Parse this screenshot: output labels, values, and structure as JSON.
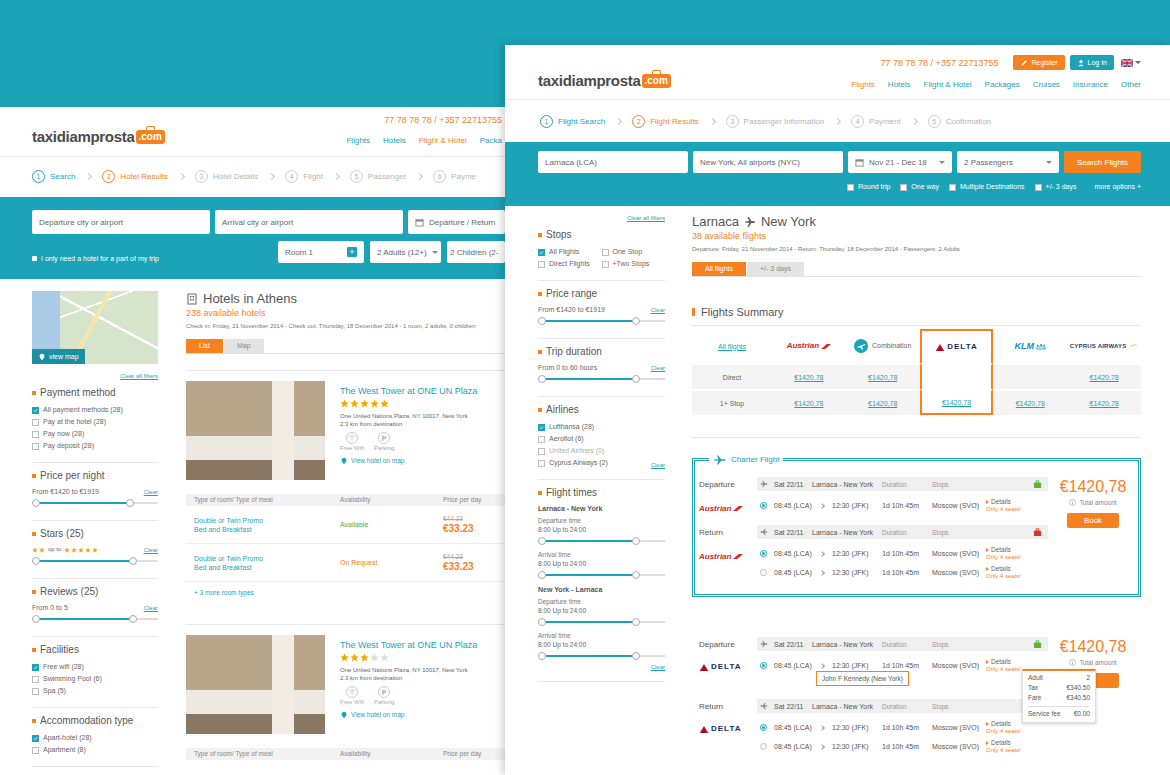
{
  "hotel_page": {
    "header": {
      "logo": {
        "name": "taxidiamprosta",
        "tld": ".com"
      },
      "phone": "77 78 78 78 / +357 22713755",
      "nav": [
        {
          "label": "Flights",
          "selected": false
        },
        {
          "label": "Hotels",
          "selected": false
        },
        {
          "label": "Flight & Hotel",
          "selected": true
        },
        {
          "label": "Packa",
          "selected": false
        }
      ]
    },
    "steps": [
      {
        "number": "1",
        "label": "Search",
        "done": true,
        "selected": false
      },
      {
        "number": "2",
        "label": "Hotel Results",
        "done": false,
        "selected": true
      },
      {
        "number": "3",
        "label": "Hotel Details",
        "done": false,
        "selected": false
      },
      {
        "number": "4",
        "label": "Flight",
        "done": false,
        "selected": false
      },
      {
        "number": "5",
        "label": "Passenger",
        "done": false,
        "selected": false
      },
      {
        "number": "6",
        "label": "Payme",
        "done": false,
        "selected": false
      }
    ],
    "search": {
      "departure": "Departure city or airport",
      "arrival": "Arrival city or airport",
      "dates": "Departure / Return",
      "room": "Room 1",
      "room_add": "+",
      "adults": "2 Adults (12+)",
      "children": "2 Children (2-",
      "partial_stay": {
        "label": "I only need a hotel for a part of my trip",
        "checked": false
      }
    },
    "sidebar": {
      "map_button": "view map",
      "clear_all": "Clear all filters",
      "filters": [
        {
          "kind": "checkbox",
          "title": "Payment method",
          "options": [
            {
              "label": "All payment methods (28)",
              "checked": true,
              "disabled": false
            },
            {
              "label": "Pay at the hotel (28)",
              "checked": false,
              "disabled": false
            },
            {
              "label": "Pay now (28)",
              "checked": false,
              "disabled": false
            },
            {
              "label": "Pay deposit (28)",
              "checked": false,
              "disabled": false
            }
          ]
        },
        {
          "kind": "range",
          "title": "Price per night",
          "reading": "From €1420 to €1919",
          "clear": "Clear",
          "start": 0.03,
          "level": 0.78
        },
        {
          "kind": "stars",
          "title": "Stars (25)",
          "from_stars": 2,
          "to_label": "up to",
          "to_stars": 5,
          "clear": "Clear",
          "start": 0.03,
          "level": 0.8
        },
        {
          "kind": "range",
          "title": "Reviews (25)",
          "reading": "From 0 to 5",
          "clear": "Clear",
          "start": 0.03,
          "level": 0.8
        },
        {
          "kind": "checkbox",
          "title": "Facilities",
          "options": [
            {
              "label": "Free wifi (28)",
              "checked": true,
              "disabled": false
            },
            {
              "label": "Swimming Pool (6)",
              "checked": false,
              "disabled": false
            },
            {
              "label": "Spa (5)",
              "checked": false,
              "disabled": false
            }
          ]
        },
        {
          "kind": "checkbox",
          "title": "Accommodation type",
          "options": [
            {
              "label": "Apart-hotel (28)",
              "checked": true,
              "disabled": false
            },
            {
              "label": "Apartment (8)",
              "checked": false,
              "disabled": false
            }
          ]
        }
      ]
    },
    "results": {
      "title": "Hotels in Athens",
      "count": "238 available hotels",
      "details": "Check in: Friday, 21 November 2014 - Check out: Thursday, 18 December 2014 - 1 room, 2 adults, 0 children",
      "tabs": [
        {
          "label": "List",
          "selected": true
        },
        {
          "label": "Map",
          "selected": false
        }
      ],
      "columns": [
        "Type of room/ Type of meal",
        "Availability",
        "Price per day"
      ],
      "hotels": [
        {
          "name": "The West Tower at ONE UN Plaza",
          "stars": 5,
          "max_stars": 5,
          "address": "One United Nations Plaza, NY 10017, New York",
          "distance": "2.3 km from destination",
          "amenities": [
            {
              "kind": "wifi",
              "label": "Free Wifi"
            },
            {
              "kind": "parking",
              "glyph": "P",
              "label": "Parking"
            }
          ],
          "map_link": "View hotel on map",
          "rooms": [
            {
              "room": "Double or Twin Promo",
              "meal": "Bed and Breakfast",
              "availability": "Available",
              "color": "#5aa832",
              "old_price": "€44.23",
              "price": "€33.23"
            },
            {
              "room": "Double or Twin Promo",
              "meal": "Bed and Breakfast",
              "availability": "On Request",
              "color": "#f5821f",
              "old_price": "€44.23",
              "price": "€33.23"
            }
          ],
          "more": "+ 3 more room types"
        },
        {
          "name": "The West Tower at ONE UN Plaza",
          "stars": 3,
          "max_stars": 5,
          "address": "One United Nations Plaza, NY 10017, New York",
          "distance": "2.3 km from destination",
          "amenities": [
            {
              "kind": "wifi",
              "label": "Free Wifi"
            },
            {
              "kind": "parking",
              "glyph": "P",
              "label": "Parking"
            }
          ],
          "map_link": "View hotel on map",
          "rooms": [],
          "more": null
        }
      ]
    }
  },
  "flight_page": {
    "header": {
      "logo": {
        "name": "taxidiamprosta",
        "tld": ".com"
      },
      "phone": "77 78 78 78 / +357 22713755",
      "auth": [
        {
          "label": "Register",
          "kind": "register"
        },
        {
          "label": "Log In",
          "kind": "login"
        }
      ],
      "nav": [
        {
          "label": "Flights",
          "selected": true
        },
        {
          "label": "Hotels",
          "selected": false
        },
        {
          "label": "Flight & Hotel",
          "selected": false
        },
        {
          "label": "Packages",
          "selected": false
        },
        {
          "label": "Cruises",
          "selected": false
        },
        {
          "label": "Insurance",
          "selected": false
        },
        {
          "label": "Other",
          "selected": false
        }
      ]
    },
    "steps": [
      {
        "number": "1",
        "label": "Flight Search",
        "done": true,
        "selected": false
      },
      {
        "number": "2",
        "label": "Flight Results",
        "done": false,
        "selected": true
      },
      {
        "number": "3",
        "label": "Passenger Information",
        "done": false,
        "selected": false
      },
      {
        "number": "4",
        "label": "Payment",
        "done": false,
        "selected": false
      },
      {
        "number": "5",
        "label": "Confirmation",
        "done": false,
        "selected": false
      }
    ],
    "search": {
      "from": "Larnaca (LCA)",
      "to": "New York, All airports (NYC)",
      "dates": "Nov 21 - Dec 18",
      "passengers": "2 Passengers",
      "button": "Search Flights",
      "options": [
        {
          "label": "Round trip",
          "checked": false,
          "disabled": false
        },
        {
          "label": "One way",
          "checked": false,
          "disabled": false
        },
        {
          "label": "Multiple Destinations",
          "checked": false,
          "disabled": false
        },
        {
          "label": "+/- 3 days",
          "checked": false,
          "disabled": false
        }
      ],
      "more": "more options +"
    },
    "sidebar": {
      "clear_all": "Clear all filters",
      "filters": [
        {
          "kind": "checkbox_grid",
          "title": "Stops",
          "options": [
            {
              "label": "All Flights",
              "checked": true,
              "disabled": false
            },
            {
              "label": "One Stop",
              "checked": false,
              "disabled": false
            },
            {
              "label": "Direct Flights",
              "checked": false,
              "disabled": false
            },
            {
              "label": "+Two Stops",
              "checked": false,
              "disabled": false
            }
          ]
        },
        {
          "kind": "range",
          "title": "Price range",
          "reading": "From €1420 to €1919",
          "clear": "Clear",
          "start": 0.03,
          "level": 0.77
        },
        {
          "kind": "range",
          "title": "Trip duration",
          "reading": "From 0 to 60 hours",
          "clear": "Clear",
          "start": 0.03,
          "level": 0.77
        },
        {
          "kind": "checkbox",
          "title": "Airlines",
          "clear": "Clear",
          "options": [
            {
              "label": "Lufthansa (28)",
              "checked": true,
              "disabled": false
            },
            {
              "label": "Aeroflot (6)",
              "checked": false,
              "disabled": false
            },
            {
              "label": "United Airlines (0)",
              "checked": false,
              "disabled": true
            },
            {
              "label": "Cyprus Airways (2)",
              "checked": false,
              "disabled": false
            }
          ]
        },
        {
          "kind": "times",
          "title": "Flight times",
          "clear": "Clear",
          "groups": [
            {
              "title": "Larnaca - New York",
              "sliders": [
                {
                  "label": "Departure time",
                  "reading": "8:00 Up to 24:00",
                  "start": 0.03,
                  "level": 0.77
                },
                {
                  "label": "Arrival time",
                  "reading": "8:00 Up to 24:00",
                  "start": 0.03,
                  "level": 0.77
                }
              ]
            },
            {
              "title": "New York - Larnaca",
              "sliders": [
                {
                  "label": "Departure time",
                  "reading": "8:00 Up to 24:00",
                  "start": 0.03,
                  "level": 0.77
                },
                {
                  "label": "Arrival time",
                  "reading": "8:00 Up to 24:00",
                  "start": 0.03,
                  "level": 0.77
                }
              ]
            }
          ]
        }
      ]
    },
    "results": {
      "from": "Larnaca",
      "to": "New York",
      "count": "38 available flights",
      "details": "Departure: Friday, 21 November 2014 - Return: Thursday, 18 December 2014 - Passengers: 2 Adults",
      "tabs": [
        {
          "label": "All flights",
          "selected": true
        },
        {
          "label": "+/- 3 days",
          "selected": false
        }
      ],
      "summary": {
        "title": "Flights Summary",
        "corner": "All flights",
        "airlines": [
          {
            "name": "Austrian",
            "kind": "austrian",
            "color": "#d7261e",
            "selected": false
          },
          {
            "name": "Combination",
            "kind": "combination",
            "color": "#1ba3b7",
            "selected": false
          },
          {
            "name": "DELTA",
            "kind": "delta",
            "color": "#16315f",
            "selected": true
          },
          {
            "name": "KLM",
            "kind": "klm",
            "color": "#0e8fd0",
            "selected": false
          },
          {
            "name": "CYPRUS AIRWAYS",
            "kind": "cyprus",
            "color": "#1d3a6b",
            "selected": false
          }
        ],
        "rows": [
          {
            "label": "Direct",
            "prices": [
              "€1420,78",
              "€1420,78",
              null,
              null,
              "€1420,78"
            ]
          },
          {
            "label": "1+ Stop",
            "prices": [
              "€1420,78",
              "€1420,78",
              "€1420,78",
              "€1420,78",
              "€1420,78"
            ]
          }
        ]
      },
      "cards": [
        {
          "kind": "charter",
          "label": "Charter Flight",
          "price": "€1420,78",
          "total": "Total amount",
          "button": "Book",
          "breakdown": [],
          "legs": [
            {
              "kind": "departure",
              "direction": "Departure",
              "date": "Sat 22/11",
              "route": "Larnaca - New York",
              "duration": "Duration",
              "stops": "Stops",
              "baggage_color": "#5cb531",
              "airline": {
                "name": "Austrian",
                "kind": "austrian",
                "color": "#d7261e"
              },
              "options": [
                {
                  "departure": "08:45 (LCA)",
                  "arrival": "12:30 (JFK)",
                  "time": "1d 10h 45m",
                  "via": "Moscow (SVO)",
                  "details": "Details",
                  "seats": "Only 4 seats!",
                  "selected": true,
                  "tooltip": null
                }
              ]
            },
            {
              "kind": "return",
              "direction": "Return",
              "date": "Sat 22/11",
              "route": "Larnaca - New York",
              "duration": "Duration",
              "stops": "Stops",
              "baggage_color": "#d9342b",
              "airline": {
                "name": "Austrian",
                "kind": "austrian",
                "color": "#d7261e"
              },
              "options": [
                {
                  "departure": "08:45 (LCA)",
                  "arrival": "12:30 (JFK)",
                  "time": "1d 10h 45m",
                  "via": "Moscow (SVO)",
                  "details": "Details",
                  "seats": "Only 4 seats!",
                  "selected": true,
                  "tooltip": null
                },
                {
                  "departure": "08:45 (LCA)",
                  "arrival": "12:30 (JFK)",
                  "time": "1d 10h 45m",
                  "via": "Moscow (SVO)",
                  "details": "Details",
                  "seats": "Only 4 seats!",
                  "selected": false,
                  "tooltip": null
                }
              ]
            }
          ]
        },
        {
          "kind": "regular",
          "label": null,
          "price": "€1420,78",
          "total": "Total amount",
          "button": null,
          "breakdown": [
            {
              "label": "Adult",
              "value": "2"
            },
            {
              "label": "Tax",
              "value": "€340.50"
            },
            {
              "label": "Fare",
              "value": "€340.50"
            },
            {
              "label": "Service fee",
              "value": "€0.00"
            }
          ],
          "legs": [
            {
              "kind": "departure",
              "direction": "Departure",
              "date": "Sat 22/11",
              "route": "Larnaca - New York",
              "duration": "Duration",
              "stops": "Stops",
              "baggage_color": "#5cb531",
              "airline": {
                "name": "DELTA",
                "kind": "delta",
                "color": "#16315f"
              },
              "options": [
                {
                  "departure": "08:45 (LCA)",
                  "arrival": "12:30 (JFK)",
                  "time": "1d 10h 45m",
                  "via": "Moscow (SVO)",
                  "details": "Details",
                  "seats": "Only 4 seats!",
                  "selected": true,
                  "tooltip": "John F Kennedy (New York)"
                }
              ]
            },
            {
              "kind": "return",
              "direction": "Return",
              "date": "Sat 22/11",
              "route": "Larnaca - New York",
              "duration": "Duration",
              "stops": "Stops",
              "baggage_color": "#d9342b",
              "airline": {
                "name": "DELTA",
                "kind": "delta",
                "color": "#16315f"
              },
              "options": [
                {
                  "departure": "08:45 (LCA)",
                  "arrival": "12:30 (JFK)",
                  "time": "1d 10h 45m",
                  "via": "Moscow (SVO)",
                  "details": "Details",
                  "seats": "Only 4 seats!",
                  "selected": true,
                  "tooltip": null
                },
                {
                  "departure": "08:45 (LCA)",
                  "arrival": "12:30 (JFK)",
                  "time": "1d 10h 45m",
                  "via": "Moscow (SVO)",
                  "details": "Details",
                  "seats": "Only 4 seats!",
                  "selected": false,
                  "tooltip": null
                }
              ]
            }
          ]
        }
      ]
    }
  }
}
